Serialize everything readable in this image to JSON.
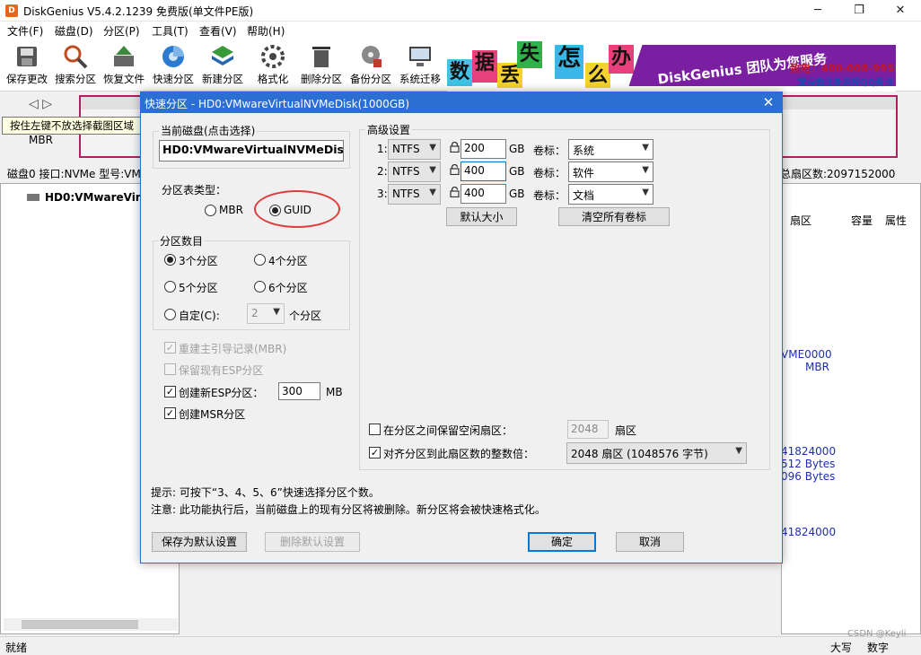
{
  "window": {
    "title": "DiskGenius V5.4.2.1239 免费版(单文件PE版)",
    "controls": {
      "minimize": "─",
      "maximize": "❐",
      "close": "✕"
    }
  },
  "menu": [
    "文件(F)",
    "磁盘(D)",
    "分区(P)",
    "工具(T)",
    "查看(V)",
    "帮助(H)"
  ],
  "toolbar": [
    {
      "label": "保存更改",
      "icon": "save-icon"
    },
    {
      "label": "搜索分区",
      "icon": "search-icon"
    },
    {
      "label": "恢复文件",
      "icon": "recover-icon"
    },
    {
      "label": "快速分区",
      "icon": "quick-partition-icon"
    },
    {
      "label": "新建分区",
      "icon": "new-partition-icon"
    },
    {
      "label": "格式化",
      "icon": "format-icon"
    },
    {
      "label": "删除分区",
      "icon": "delete-icon"
    },
    {
      "label": "备份分区",
      "icon": "backup-icon"
    },
    {
      "label": "系统迁移",
      "icon": "migrate-icon"
    }
  ],
  "banner": {
    "chars": [
      "数",
      "据",
      "丢",
      "失",
      "怎",
      "么",
      "办"
    ],
    "slogan": "DiskGenius 团队为您服务",
    "phone": "致电：400-008-9958",
    "qq": "或点击此处选择QQ咨询",
    "colors": {
      "ribbon": "#7b1fa2",
      "phone": "#c0182a"
    }
  },
  "background": {
    "tooltip": "按住左键不放选择截图区域",
    "nav_arrows": "◁ ▷",
    "mbr": "MBR",
    "disk_info": "磁盘0 接口:NVMe  型号:VM",
    "disk_info_right": "总扇区数:2097152000",
    "tree_item": "HD0:VMwareVir",
    "columns": [
      "扇区",
      "容量",
      "属性"
    ],
    "right_values": [
      "VME0000",
      "MBR",
      "41824000",
      "512 Bytes",
      "096 Bytes",
      "41824000"
    ],
    "status_left": "就绪",
    "status_mid": "大写",
    "status_right": "数字",
    "watermark": "CSDN @Keyli"
  },
  "dialog": {
    "title": "快速分区 - HD0:VMwareVirtualNVMeDisk(1000GB)",
    "close": "✕",
    "current_disk": {
      "label": "当前磁盘(点击选择)",
      "value": "HD0:VMwareVirtualNVMeDisk"
    },
    "partition_table": {
      "label": "分区表类型：",
      "options": [
        "MBR",
        "GUID"
      ],
      "selected": "GUID"
    },
    "partition_count": {
      "label": "分区数目",
      "options": [
        "3个分区",
        "4个分区",
        "5个分区",
        "6个分区"
      ],
      "custom_label": "自定(C):",
      "custom_value": "2",
      "custom_suffix": "个分区",
      "selected": "3个分区"
    },
    "options": {
      "rebuild_mbr": {
        "label": "重建主引导记录(MBR)",
        "checked": true,
        "disabled": true
      },
      "keep_esp": {
        "label": "保留现有ESP分区",
        "checked": false,
        "disabled": true
      },
      "new_esp": {
        "label": "创建新ESP分区：",
        "checked": true,
        "value": "300",
        "unit": "MB"
      },
      "msr": {
        "label": "创建MSR分区",
        "checked": true
      }
    },
    "advanced": {
      "label": "高级设置",
      "rows": [
        {
          "index": "1:",
          "fs": "NTFS",
          "size": "200",
          "unit": "GB",
          "vol_label": "卷标：",
          "volume": "系统"
        },
        {
          "index": "2:",
          "fs": "NTFS",
          "size": "400",
          "unit": "GB",
          "vol_label": "卷标：",
          "volume": "软件"
        },
        {
          "index": "3:",
          "fs": "NTFS",
          "size": "400",
          "unit": "GB",
          "vol_label": "卷标：",
          "volume": "文档"
        }
      ],
      "default_size_button": "默认大小",
      "clear_labels_button": "清空所有卷标",
      "reserve_free": {
        "label": "在分区之间保留空闲扇区：",
        "checked": false,
        "value": "2048",
        "unit": "扇区"
      },
      "align": {
        "label": "对齐分区到此扇区数的整数倍：",
        "checked": true,
        "value": "2048 扇区 (1048576 字节)"
      }
    },
    "hints": [
      "提示: 可按下“3、4、5、6”快速选择分区个数。",
      "注意: 此功能执行后，当前磁盘上的现有分区将被删除。新分区将会被快速格式化。"
    ],
    "buttons": {
      "save_default": "保存为默认设置",
      "delete_default": "删除默认设置",
      "ok": "确定",
      "cancel": "取消"
    },
    "highlight_color": "#e23b3b"
  }
}
